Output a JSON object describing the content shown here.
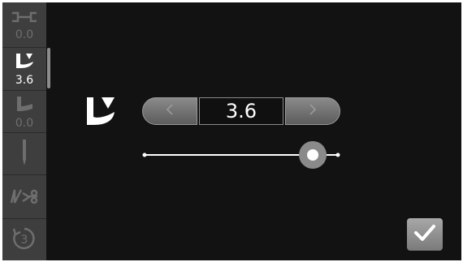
{
  "sidebar": {
    "items": [
      {
        "icon": "stitch-width-icon",
        "value": "0.0",
        "active": false
      },
      {
        "icon": "presser-foot-pressure-icon",
        "value": "3.6",
        "active": true
      },
      {
        "icon": "presser-foot-height-icon",
        "value": "0.0",
        "active": false
      },
      {
        "icon": "needle-icon",
        "value": "",
        "active": false
      },
      {
        "icon": "thread-cut-icon",
        "value": "",
        "active": false
      },
      {
        "icon": "reverse-stitch-3-icon",
        "value": "",
        "active": false
      }
    ]
  },
  "main": {
    "setting_icon": "presser-foot-pressure-icon",
    "value": "3.6",
    "slider_fraction": 0.87
  },
  "colors": {
    "background": "#121212",
    "sidebar": "#3e3e3e",
    "button": "#7a7a7a",
    "active_text": "#ffffff",
    "inactive_text": "#6e6e6e"
  },
  "confirm_icon": "checkmark-icon"
}
